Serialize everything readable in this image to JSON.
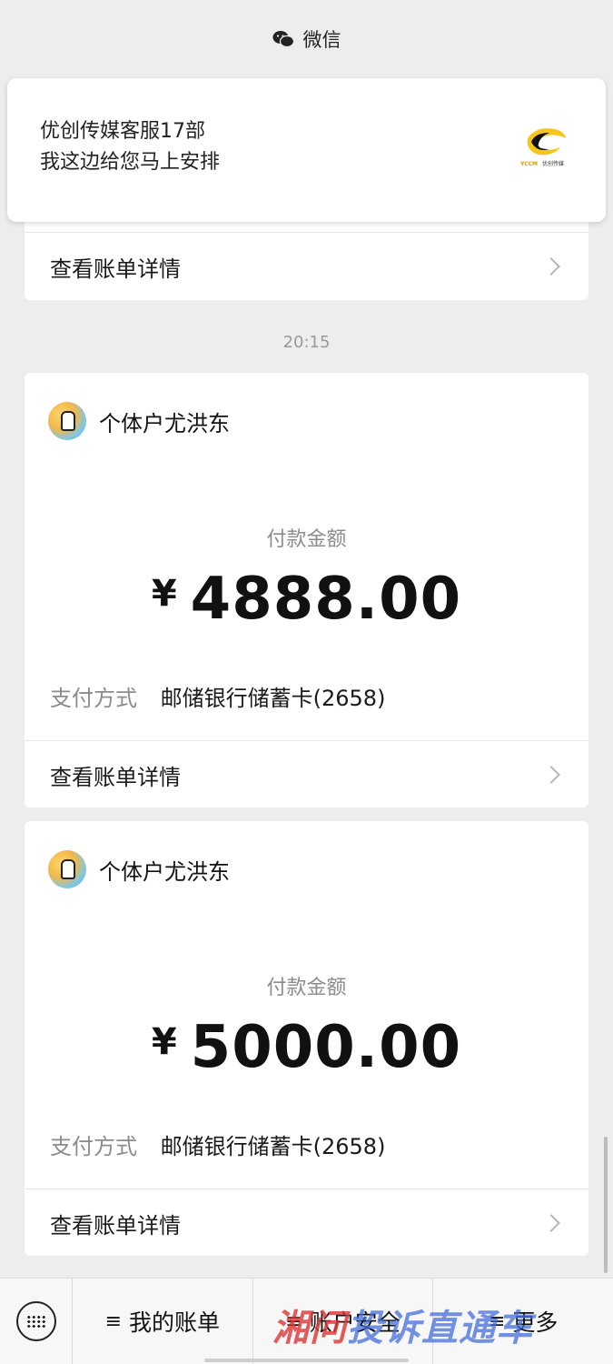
{
  "top": {
    "app_name": "微信"
  },
  "notification": {
    "sender": "优创传媒客服17部",
    "message": "我这边给您马上安排",
    "logo_text": "YCCM 优创传媒"
  },
  "partial_card": {
    "detail_label": "查看账单详情"
  },
  "timestamp": "20:15",
  "payments": [
    {
      "merchant": "个体户尤洪东",
      "amount_label": "付款金额",
      "currency": "¥",
      "amount": "4888.00",
      "method_label": "支付方式",
      "method_value": "邮储银行储蓄卡(2658)",
      "detail_label": "查看账单详情"
    },
    {
      "merchant": "个体户尤洪东",
      "amount_label": "付款金额",
      "currency": "¥",
      "amount": "5000.00",
      "method_label": "支付方式",
      "method_value": "邮储银行储蓄卡(2658)",
      "detail_label": "查看账单详情"
    }
  ],
  "bottom_menu": {
    "items": [
      {
        "icon": "≡",
        "label": "我的账单"
      },
      {
        "icon": "≡",
        "label": "账户安全"
      },
      {
        "icon": "≡",
        "label": "更多"
      }
    ]
  },
  "watermark": {
    "part1": "湘问",
    "part2": "投诉直通车"
  }
}
